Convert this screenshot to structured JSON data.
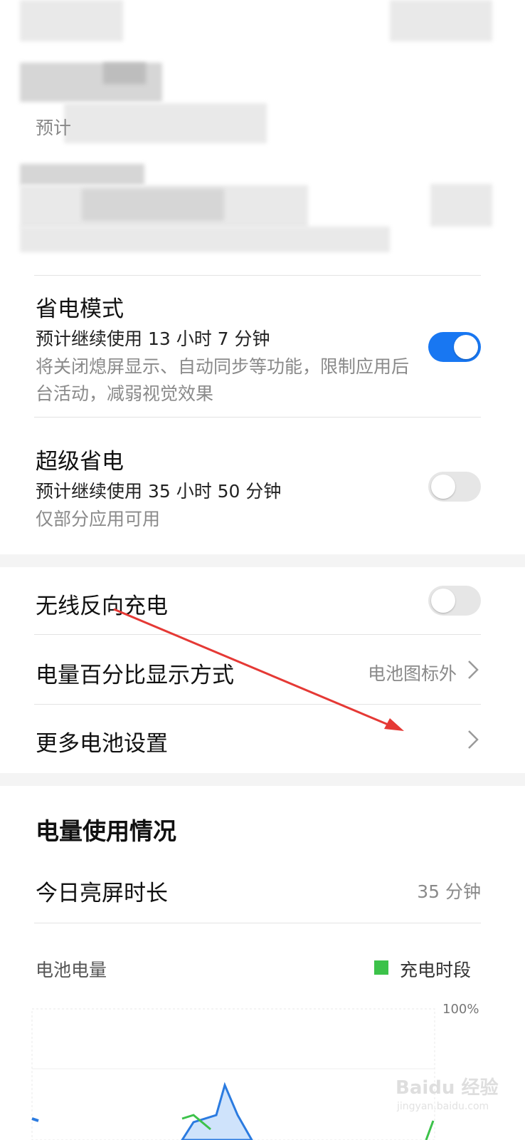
{
  "top_partial": {
    "fragment": "预计"
  },
  "power_saving": {
    "title": "省电模式",
    "estimate": "预计继续使用 13 小时 7 分钟",
    "description": "将关闭熄屏显示、自动同步等功能，限制应用后台活动，减弱视觉效果",
    "enabled": true
  },
  "super_saving": {
    "title": "超级省电",
    "estimate": "预计继续使用 35 小时 50 分钟",
    "description": "仅部分应用可用",
    "enabled": false
  },
  "wireless_reverse": {
    "title": "无线反向充电",
    "enabled": false
  },
  "battery_percentage": {
    "title": "电量百分比显示方式",
    "value": "电池图标外"
  },
  "more_settings": {
    "title": "更多电池设置"
  },
  "usage": {
    "heading": "电量使用情况",
    "screen_time_label": "今日亮屏时长",
    "screen_time_value": "35 分钟",
    "battery_level_label": "电池电量",
    "legend_charging": "充电时段",
    "y_max_label": "100%"
  },
  "watermark": {
    "text": "Baidu 经验",
    "sub": "jingyan.baidu.com"
  },
  "colors": {
    "accent": "#1877f2",
    "charging_green": "#3cc24a",
    "annotation_red": "#e53935"
  }
}
